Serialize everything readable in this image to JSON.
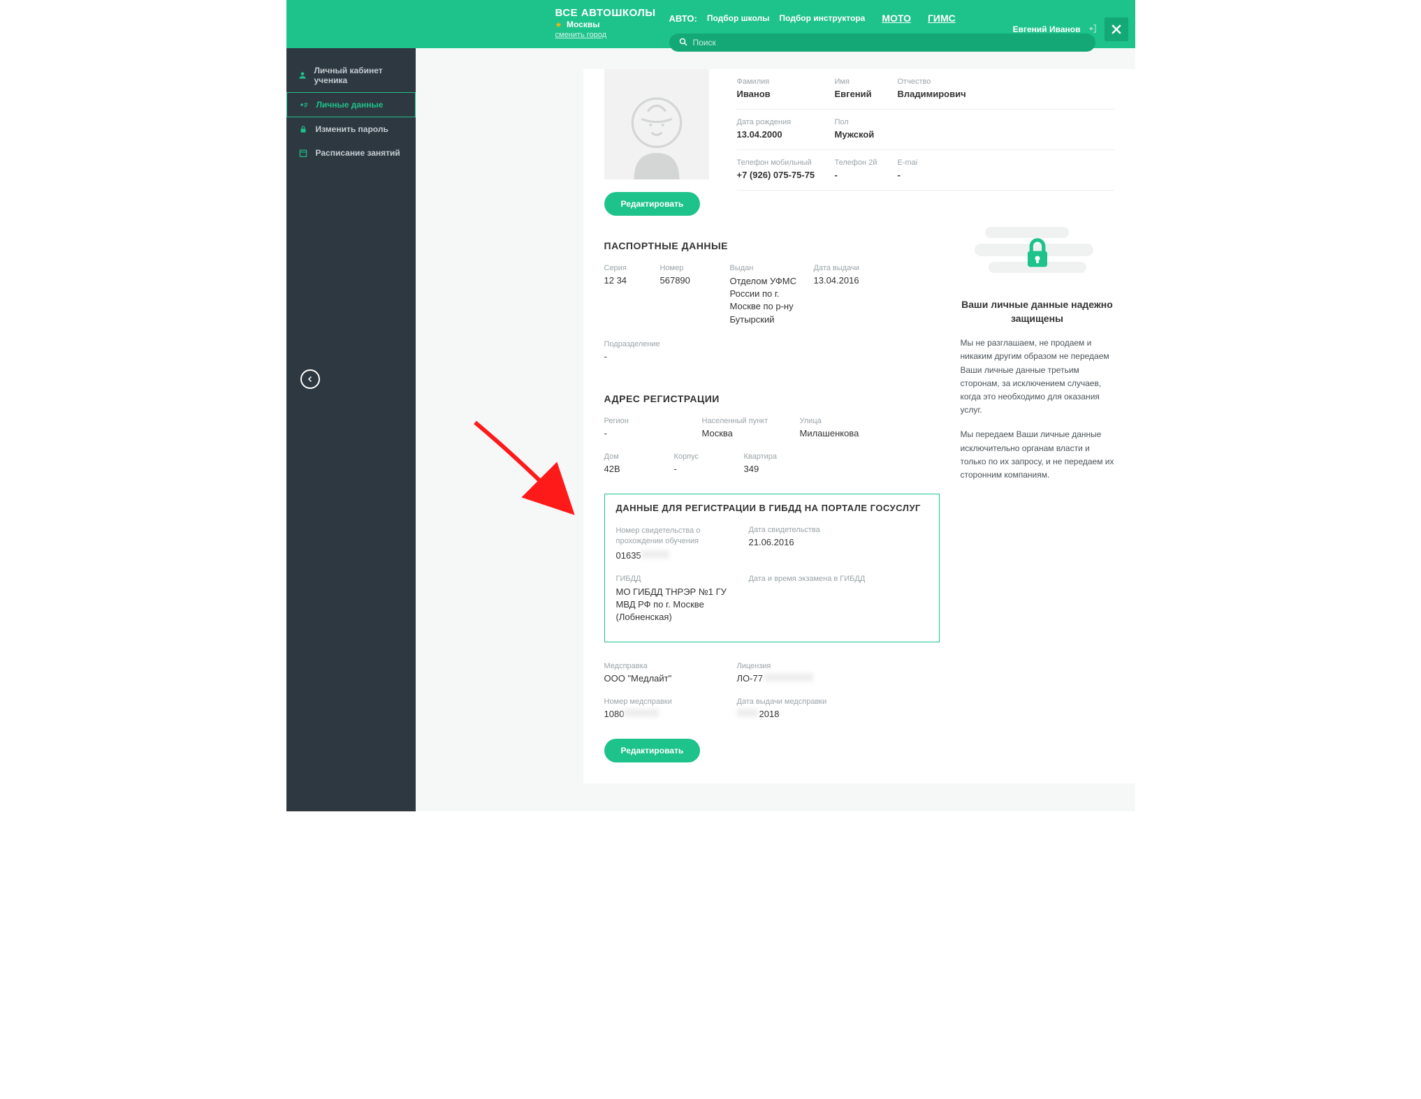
{
  "header": {
    "brand_title": "ВСЕ АВТОШКОЛЫ",
    "brand_city": "Москвы",
    "brand_change": "сменить город",
    "nav_auto": "АВТО:",
    "nav_school": "Подбор школы",
    "nav_instructor": "Подбор инструктора",
    "nav_moto": "МОТО",
    "nav_gims": "ГИМС",
    "search_placeholder": "Поиск",
    "user_name": "Евгений Иванов"
  },
  "sidebar": {
    "items": [
      {
        "label": "Личный кабинет ученика",
        "icon": "user"
      },
      {
        "label": "Личные данные",
        "icon": "id",
        "active": true
      },
      {
        "label": "Изменить пароль",
        "icon": "lock"
      },
      {
        "label": "Расписание занятий",
        "icon": "calendar"
      }
    ]
  },
  "profile": {
    "surname_label": "Фамилия",
    "surname": "Иванов",
    "name_label": "Имя",
    "name": "Евгений",
    "patronymic_label": "Отчество",
    "patronymic": "Владимирович",
    "dob_label": "Дата рождения",
    "dob": "13.04.2000",
    "gender_label": "Пол",
    "gender": "Мужской",
    "phone_label": "Телефон мобильный",
    "phone": "+7 (926) 075-75-75",
    "phone2_label": "Телефон 2й",
    "phone2": "-",
    "email_label": "E-mai",
    "email": "-",
    "edit_btn": "Редактировать"
  },
  "passport": {
    "title": "ПАСПОРТНЫЕ ДАННЫЕ",
    "series_label": "Серия",
    "series": "12 34",
    "number_label": "Номер",
    "number": "567890",
    "issued_label": "Выдан",
    "issued": "Отделом УФМС России по г. Москве по р-ну Бутырский",
    "date_label": "Дата выдачи",
    "date": "13.04.2016",
    "div_label": "Подразделение",
    "div": "-"
  },
  "address": {
    "title": "АДРЕС РЕГИСТРАЦИИ",
    "region_label": "Регион",
    "region": "-",
    "city_label": "Населенный пункт",
    "city": "Москва",
    "street_label": "Улица",
    "street": "Милашенкова",
    "house_label": "Дом",
    "house": "42В",
    "building_label": "Корпус",
    "building": "-",
    "flat_label": "Квартира",
    "flat": "349"
  },
  "gibdd": {
    "title": "ДАННЫЕ ДЛЯ РЕГИСТРАЦИИ В ГИБДД НА ПОРТАЛЕ ГОСУСЛУГ",
    "cert_label": "Номер свидетельства о прохождении обучения",
    "cert": "01635",
    "cert_date_label": "Дата свидетельства",
    "cert_date": "21.06.2016",
    "dept_label": "ГИБДД",
    "dept": "МО ГИБДД ТНРЭР №1 ГУ МВД РФ по г. Москве (Лобненская)",
    "exam_label": "Дата и время экзамена в ГИБДД",
    "exam": ""
  },
  "med": {
    "ref_label": "Медсправка",
    "ref": "ООО \"Медлайт\"",
    "lic_label": "Лицензия",
    "lic": "ЛО-77",
    "num_label": "Номер медсправки",
    "num": "1080",
    "date_label": "Дата выдачи медсправки",
    "date_suffix": "2018",
    "edit_btn": "Редактировать"
  },
  "side": {
    "title": "Ваши личные данные надежно защищены",
    "p1": "Мы не разглашаем, не продаем и никаким другим образом не передаем Ваши личные данные третьим сторонам, за исключением случаев, когда это необходимо для оказания услуг.",
    "p2": "Мы передаем Ваши личные данные исключительно органам власти и только по их запросу, и не передаем их сторонним компаниям."
  }
}
